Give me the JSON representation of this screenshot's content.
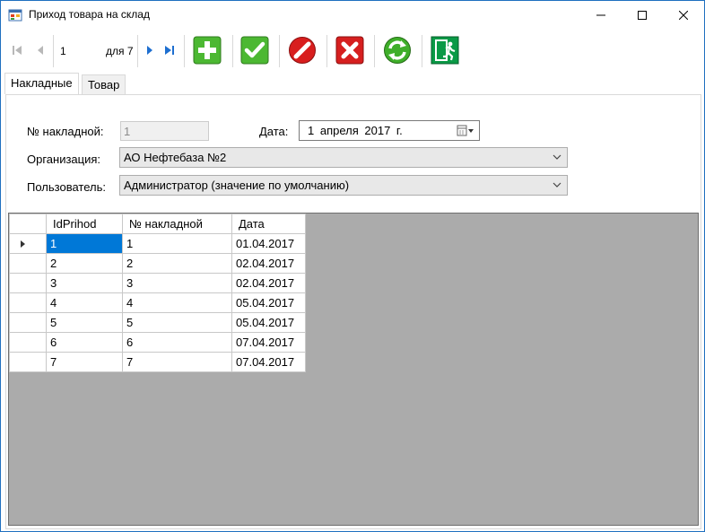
{
  "window": {
    "title": "Приход товара на склад"
  },
  "navigator": {
    "position": "1",
    "count_label": "для 7"
  },
  "toolbar_icons": [
    "add-icon",
    "check-icon",
    "edit-icon",
    "delete-icon",
    "refresh-icon",
    "exit-icon"
  ],
  "tabs": [
    {
      "label": "Накладные",
      "active": true
    },
    {
      "label": "Товар",
      "active": false
    }
  ],
  "form": {
    "invoice_no_label": "№ накладной:",
    "invoice_no_value": "1",
    "date_label": "Дата:",
    "date_value": "1  апреля  2017 г.",
    "org_label": "Организация:",
    "org_value": "АО Нефтебаза №2",
    "user_label": "Пользователь:",
    "user_value": "Администратор (значение по умолчанию)"
  },
  "grid": {
    "columns": [
      "IdPrihod",
      "№ накладной",
      "Дата"
    ],
    "rows": [
      [
        "1",
        "1",
        "01.04.2017"
      ],
      [
        "2",
        "2",
        "02.04.2017"
      ],
      [
        "3",
        "3",
        "02.04.2017"
      ],
      [
        "4",
        "4",
        "05.04.2017"
      ],
      [
        "5",
        "5",
        "05.04.2017"
      ],
      [
        "6",
        "6",
        "07.04.2017"
      ],
      [
        "7",
        "7",
        "07.04.2017"
      ]
    ]
  },
  "colors": {
    "selection": "#0078d7",
    "grid_background": "#ababab",
    "window_border": "#1f6fc0"
  }
}
